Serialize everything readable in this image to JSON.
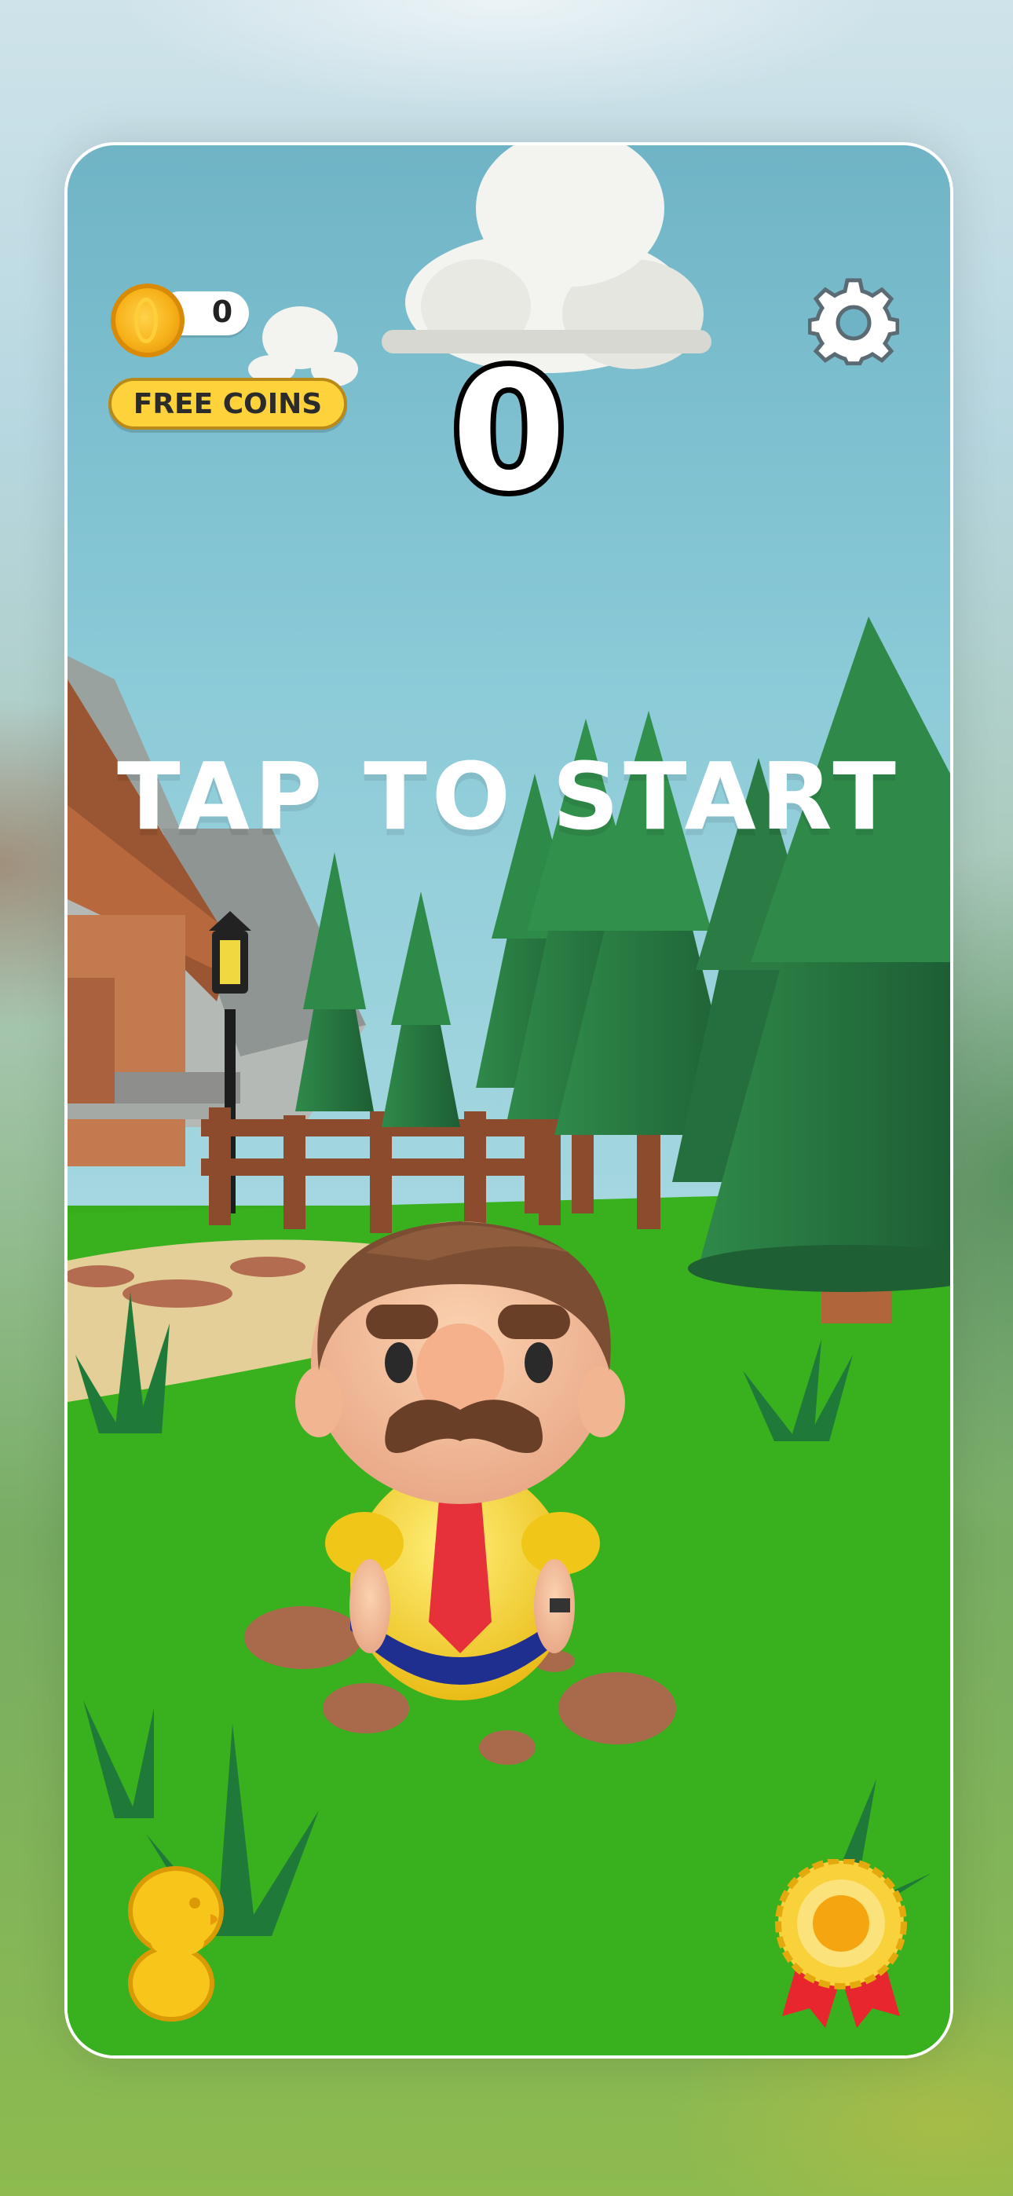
{
  "hud": {
    "coin_count": "0",
    "free_coins_label": "FREE COINS",
    "score": "0",
    "prompt": "TAP TO START"
  },
  "icons": {
    "coin": "coin-icon",
    "settings": "gear-icon",
    "character_select": "duck-icon",
    "achievements": "award-ribbon-icon"
  },
  "colors": {
    "sky": "#6fb6c8",
    "grass": "#37ad1c",
    "coin_gold": "#f7b21a",
    "free_coins_bg": "#fdd23b",
    "duck": "#f8c51a",
    "shirt": "#f4d21e",
    "tie": "#e6303a"
  }
}
